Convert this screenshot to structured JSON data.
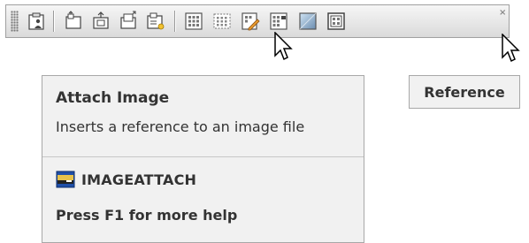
{
  "toolbar": {
    "buttons": [
      {
        "icon": "clipboard-user-icon"
      },
      {
        "icon": "paste-arrow-icon"
      },
      {
        "icon": "paste-up-icon"
      },
      {
        "icon": "paste-back-icon"
      },
      {
        "icon": "paste-gear-icon"
      },
      {
        "icon": "attach-image-grid-icon"
      },
      {
        "icon": "dotted-grid-icon"
      },
      {
        "icon": "edit-grid-pencil-icon"
      },
      {
        "icon": "grid-flag-icon"
      },
      {
        "icon": "gradient-image-icon"
      },
      {
        "icon": "framed-grid-icon"
      }
    ],
    "close_label": "×"
  },
  "tooltip": {
    "title": "Attach Image",
    "description": "Inserts a reference to an image file",
    "command_icon": "image-attach-icon",
    "command": "IMAGEATTACH",
    "help": "Press F1 for more help"
  },
  "tooltip_small": {
    "label": "Reference"
  },
  "colors": {
    "toolbar_top": "#f6f6f6",
    "toolbar_bottom": "#dadada",
    "tooltip_bg": "#f1f1f1",
    "border": "#a8a8a8"
  }
}
